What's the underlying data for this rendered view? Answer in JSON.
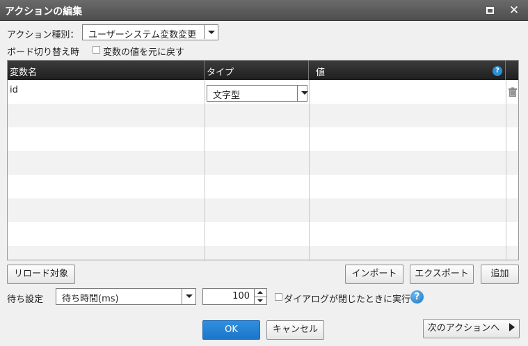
{
  "window": {
    "title": "アクションの編集",
    "maximize_icon": "maximize-icon",
    "close_label": "✕"
  },
  "form": {
    "action_type_label": "アクション種別：",
    "action_type_value": "ユーザーシステム変数変更",
    "board_switch_label": "ボード切り替え時",
    "restore_checkbox_label": "変数の値を元に戻す",
    "restore_checked": false
  },
  "grid": {
    "headers": [
      "変数名",
      "タイプ",
      "値"
    ],
    "help_icon": "help-icon",
    "rows": [
      {
        "name": "id",
        "type": "文字型",
        "value": ""
      }
    ],
    "delete_icon": "trash-icon"
  },
  "buttons": {
    "reload_target": "リロード対象",
    "import": "インポート",
    "export": "エクスポート",
    "add": "追加",
    "ok": "OK",
    "cancel": "キャンセル",
    "next_action": "次のアクションへ"
  },
  "wait": {
    "label": "待ち設定",
    "mode_value": "待ち時間(ms)",
    "time_value": "100",
    "checkbox_label": "ダイアログが閉じたときに実行",
    "checked": false
  },
  "colors": {
    "accent": "#1d76c8",
    "header_dark": "#1e1e1e",
    "titlebar": "#555555"
  }
}
